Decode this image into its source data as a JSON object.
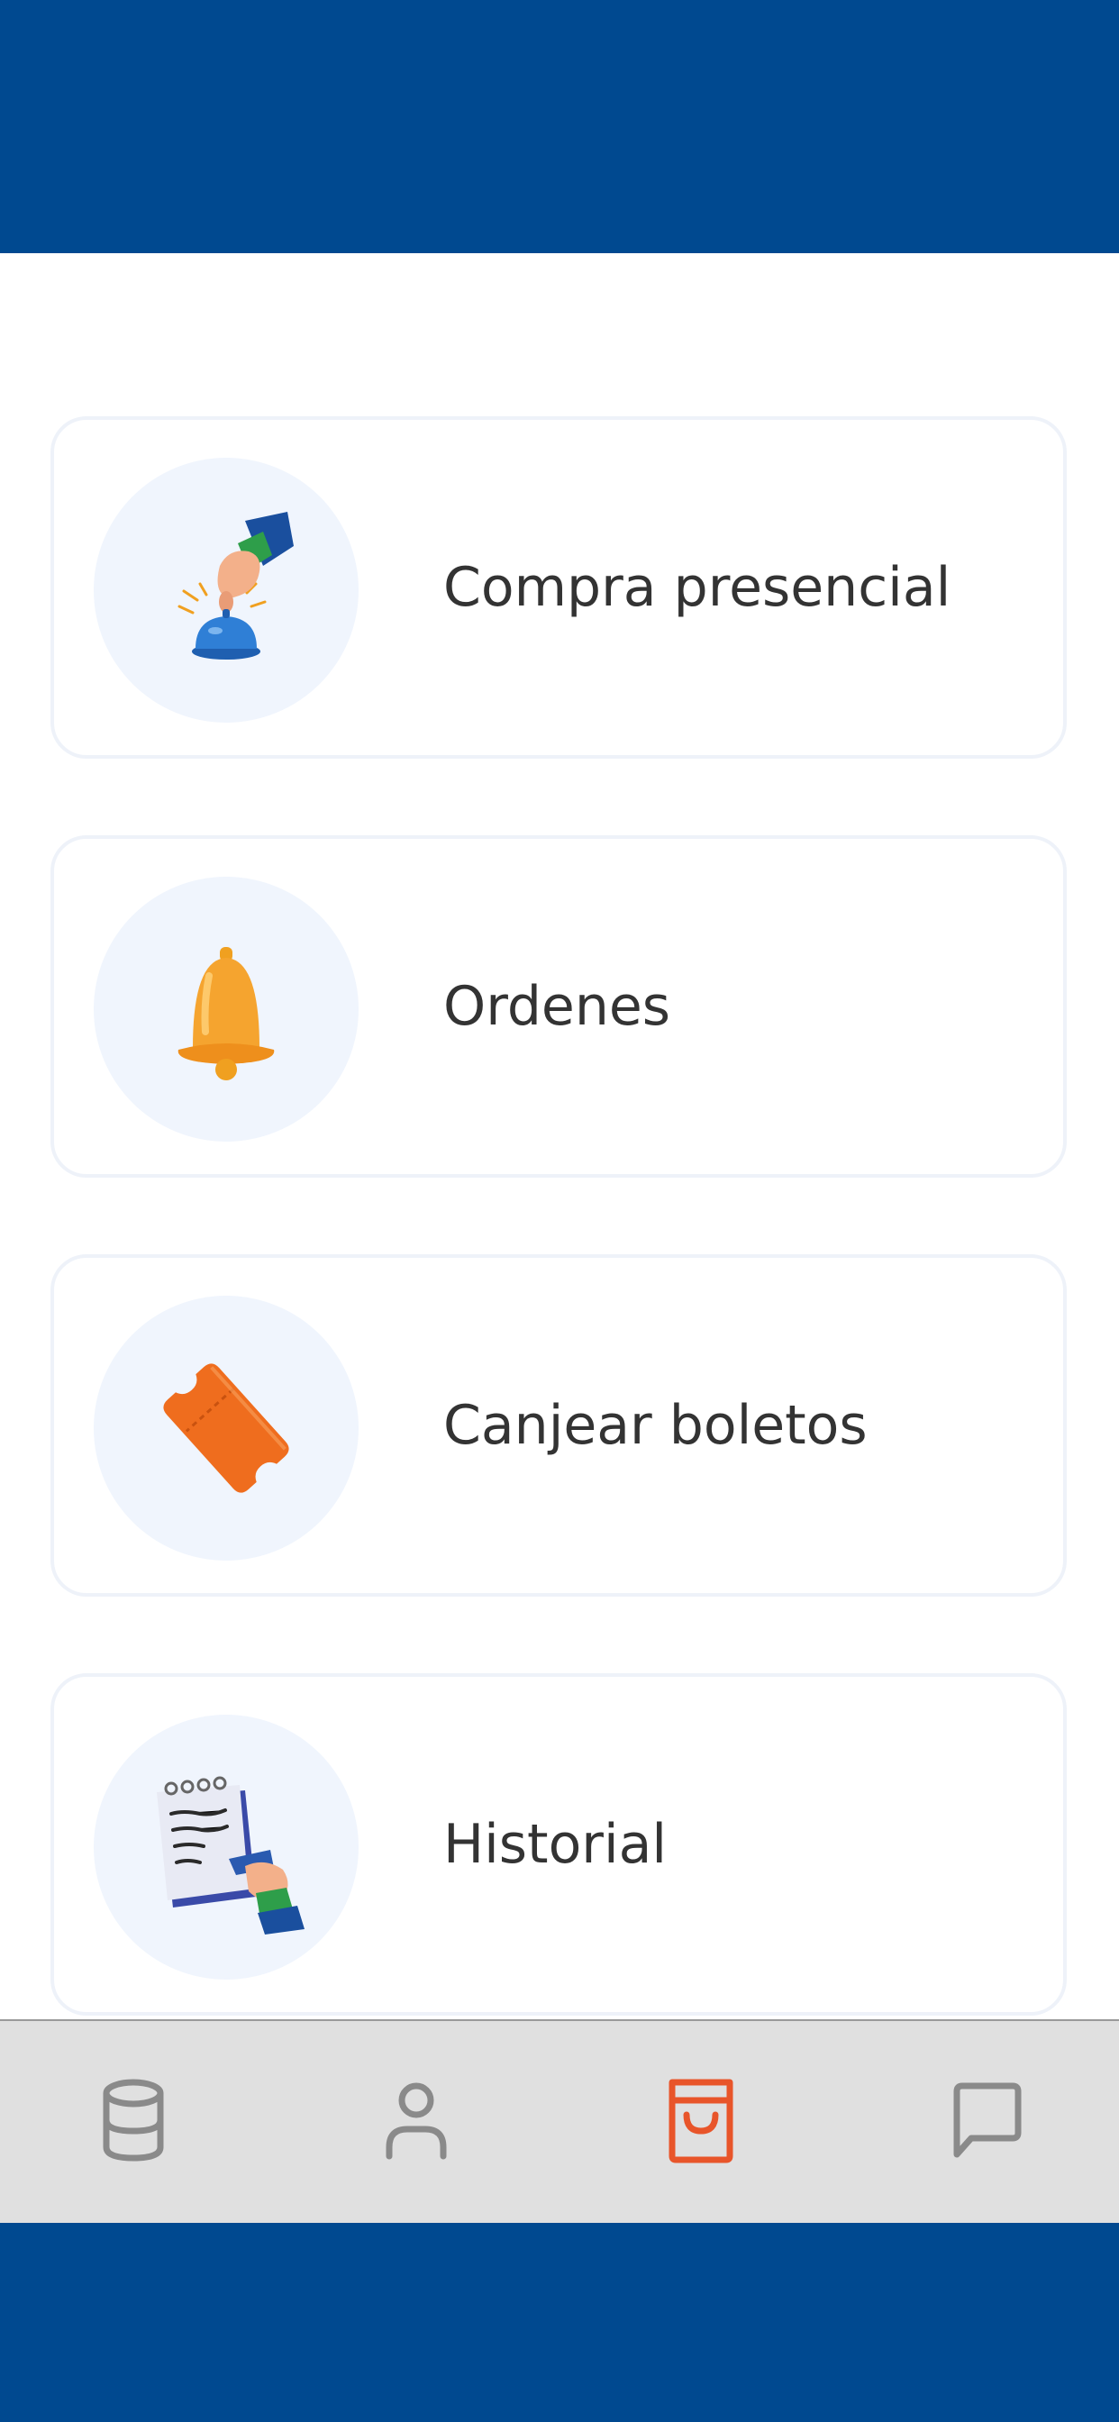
{
  "menu": {
    "items": [
      {
        "label": "Compra presencial",
        "icon": "bell-press-icon"
      },
      {
        "label": "Ordenes",
        "icon": "bell-icon"
      },
      {
        "label": "Canjear boletos",
        "icon": "ticket-icon"
      },
      {
        "label": "Historial",
        "icon": "notepad-writing-icon"
      }
    ]
  },
  "bottom_nav": {
    "items": [
      {
        "icon": "database-icon",
        "active": false
      },
      {
        "icon": "user-icon",
        "active": false
      },
      {
        "icon": "shopping-bag-icon",
        "active": true
      },
      {
        "icon": "chat-icon",
        "active": false
      }
    ]
  },
  "colors": {
    "brand_blue": "#004990",
    "accent_orange": "#e8552a",
    "nav_background": "#e0e0e0",
    "nav_icon_inactive": "#8a8a8a"
  }
}
